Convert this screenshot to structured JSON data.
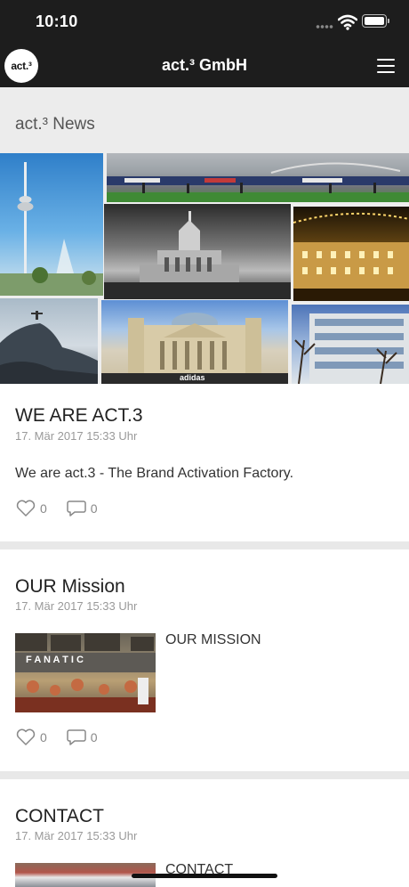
{
  "status_bar": {
    "time": "10:10"
  },
  "nav": {
    "logo_text": "act.³",
    "title": "act.³ GmbH"
  },
  "section": {
    "title": "act.³ News"
  },
  "posts": [
    {
      "title": "WE ARE ACT.3",
      "date": "17. Mär 2017 15:33 Uhr",
      "body": "We are act.3 - The Brand Activation Factory.",
      "likes": "0",
      "comments": "0"
    },
    {
      "title": "OUR Mission",
      "date": "17. Mär 2017 15:33 Uhr",
      "side_text": "OUR MISSION",
      "thumb_text": "F A N A T I C",
      "likes": "0",
      "comments": "0"
    },
    {
      "title": "CONTACT",
      "date": "17. Mär 2017 15:33 Uhr",
      "side_text": "CONTACT"
    }
  ],
  "hero": {
    "sign_text": "adidas"
  },
  "colors": {
    "bar": "#1d1d1d",
    "header_bg": "#ececec",
    "divider": "#e8e8e8"
  }
}
